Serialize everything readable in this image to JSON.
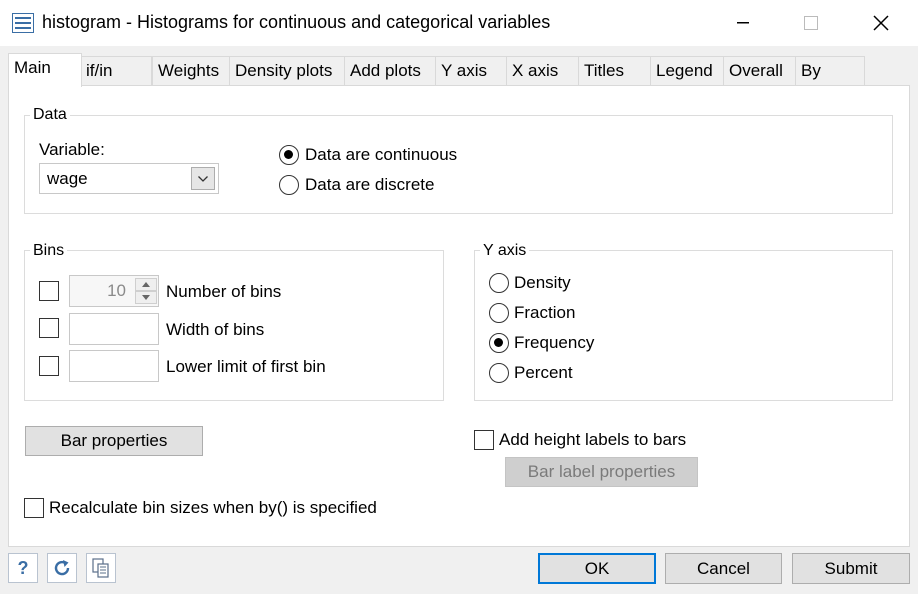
{
  "window": {
    "title": "histogram - Histograms for continuous and categorical variables",
    "minimize": "—",
    "maximize": "☐",
    "close": "✕"
  },
  "tabs": [
    {
      "label": "Main"
    },
    {
      "label": "if/in"
    },
    {
      "label": "Weights"
    },
    {
      "label": "Density plots"
    },
    {
      "label": "Add plots"
    },
    {
      "label": "Y axis"
    },
    {
      "label": "X axis"
    },
    {
      "label": "Titles"
    },
    {
      "label": "Legend"
    },
    {
      "label": "Overall"
    },
    {
      "label": "By"
    }
  ],
  "data_group": {
    "legend": "Data",
    "variable_label": "Variable:",
    "variable_value": "wage",
    "continuous_label": "Data are continuous",
    "discrete_label": "Data are discrete"
  },
  "bins_group": {
    "legend": "Bins",
    "number_value": "10",
    "number_label": "Number of bins",
    "width_label": "Width of bins",
    "lower_label": "Lower limit of first bin"
  },
  "yaxis_group": {
    "legend": "Y axis",
    "density": "Density",
    "fraction": "Fraction",
    "frequency": "Frequency",
    "percent": "Percent"
  },
  "bar_properties": "Bar properties",
  "height_labels": "Add height labels to bars",
  "bar_label_properties": "Bar label properties",
  "recalculate": "Recalculate bin sizes when by() is specified",
  "buttons": {
    "ok": "OK",
    "cancel": "Cancel",
    "submit": "Submit"
  },
  "colors": {
    "accent": "#0078d7",
    "icon_blue": "#3a6ea5"
  }
}
